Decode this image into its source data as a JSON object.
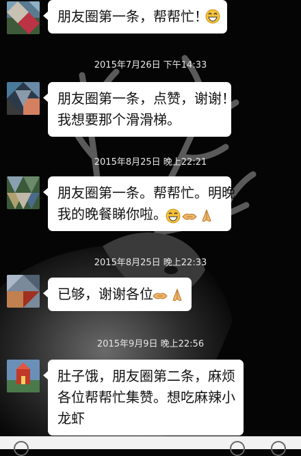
{
  "messages": [
    {
      "lines": [
        "朋友圈第一条，帮帮忙！"
      ],
      "emoji": [
        "grin-emoji"
      ]
    },
    {
      "lines": [
        "朋友圈第一条，点赞，谢谢！",
        "我想要那个滑滑梯。"
      ],
      "emoji": []
    },
    {
      "lines": [
        "朋友圈第一条。帮帮忙。明晚",
        "我的晚餐睇你啦。"
      ],
      "emoji": [
        "grin-emoji",
        "handshake-emoji",
        "pray-emoji"
      ]
    },
    {
      "lines": [
        "已够，谢谢各位"
      ],
      "emoji": [
        "handshake-emoji",
        "pray-emoji"
      ]
    },
    {
      "lines": [
        "肚子饿，朋友圈第二条，麻烦",
        "各位帮帮忙集赞。想吃麻辣小",
        "龙虾"
      ],
      "emoji": []
    }
  ],
  "timestamps": [
    "2015年7月26日 下午14:33",
    "2015年8月25日 晚上22:21",
    "2015年8月25日 晚上22:33",
    "2015年9月9日 晚上22:56"
  ],
  "colors": {
    "background": "#050505",
    "bubble": "#ffffff",
    "timestamp_text": "#e8e8e8",
    "emoji_yellow": "#f6c13a"
  }
}
